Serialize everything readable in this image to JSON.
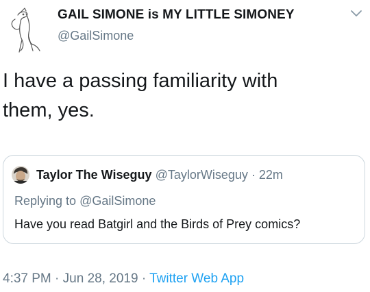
{
  "tweet": {
    "author": {
      "display_name": "GAIL SIMONE is MY LITTLE SIMONEY",
      "handle": "@GailSimone",
      "avatar_icon": "unicorn-sketch-avatar"
    },
    "menu_icon": "chevron-down-icon",
    "text_line1": "I have a passing familiarity with",
    "text_line2": "them, yes.",
    "quoted": {
      "avatar_icon": "user-avatar",
      "display_name": "Taylor The Wiseguy",
      "handle": "@TaylorWiseguy",
      "separator": "·",
      "time": "22m",
      "replying_prefix": "Replying to",
      "replying_to": "@GailSimone",
      "text": "Have you read Batgirl and the Birds of Prey comics?"
    },
    "meta": {
      "time": "4:37 PM",
      "separator1": "·",
      "date": "Jun 28, 2019",
      "separator2": "·",
      "app": "Twitter Web App"
    }
  },
  "colors": {
    "text_primary": "#14171a",
    "text_secondary": "#657786",
    "link": "#1da1f2",
    "border": "#ccd6dd"
  }
}
